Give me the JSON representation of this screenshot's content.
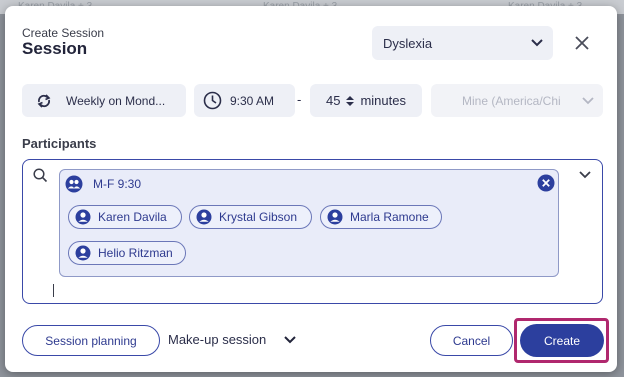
{
  "background": {
    "strip_texts": [
      "Karen Davila + 3",
      "Karen Davila + 3",
      "Karen Davila + 3"
    ]
  },
  "dialog": {
    "subtitle": "Create Session",
    "title": "Session",
    "session_type": "Dyslexia"
  },
  "schedule": {
    "recurrence": "Weekly on Mond...",
    "start_time": "9:30 AM",
    "separator": "-",
    "duration_value": "45",
    "duration_unit": "minutes",
    "timezone": "Mine (America/Chi"
  },
  "participants": {
    "label": "Participants",
    "group_name": "M-F 9:30",
    "members": [
      "Karen Davila",
      "Krystal Gibson",
      "Marla Ramone",
      "Helio Ritzman"
    ]
  },
  "footer": {
    "planning_label": "Session planning",
    "makeup_label": "Make-up session",
    "cancel_label": "Cancel",
    "create_label": "Create"
  },
  "colors": {
    "accent": "#2c3f9e",
    "highlight": "#b0286e",
    "field_bg": "#eef0f6"
  },
  "icons": [
    "repeat-icon",
    "clock-icon",
    "stepper-icon",
    "chevron-down-icon",
    "close-icon",
    "search-icon",
    "group-icon",
    "person-icon"
  ]
}
